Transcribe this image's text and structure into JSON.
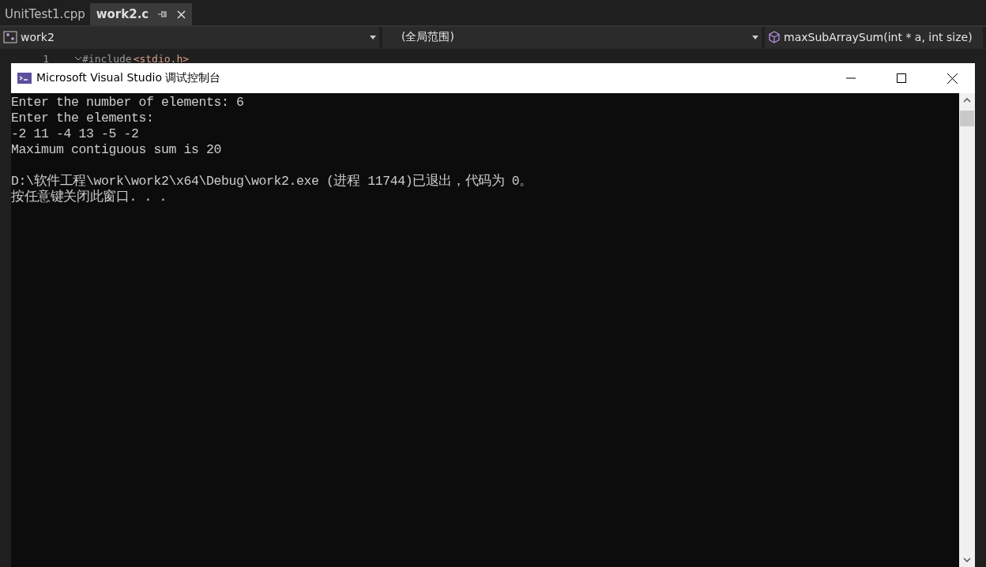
{
  "tabs": [
    {
      "label": "UnitTest1.cpp",
      "selected": false
    },
    {
      "label": "work2.c",
      "selected": true
    }
  ],
  "nav_bar": {
    "project": "work2",
    "scope": "(全局范围)",
    "member": "maxSubArraySum(int * a, int size)"
  },
  "editor": {
    "lines": [
      {
        "number": "1",
        "directive": "#include",
        "header": "<stdio.h>"
      }
    ]
  },
  "console": {
    "title": "Microsoft Visual Studio 调试控制台",
    "lines": [
      "Enter the number of elements: 6",
      "Enter the elements:",
      "-2 11 -4 13 -5 -2",
      "Maximum contiguous sum is 20"
    ],
    "exit_lines": [
      "D:\\软件工程\\work\\work2\\x64\\Debug\\work2.exe (进程 11744)已退出，代码为 0。",
      "按任意键关闭此窗口. . ."
    ]
  }
}
